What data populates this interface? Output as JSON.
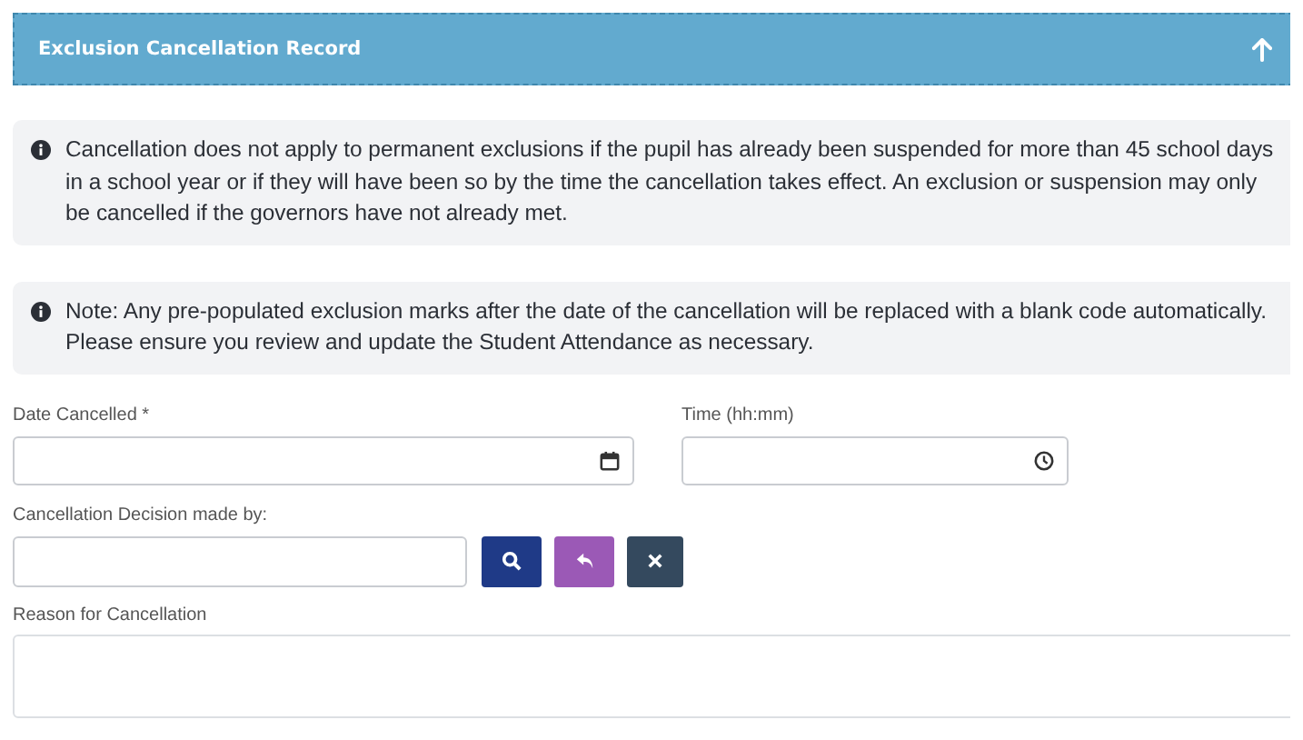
{
  "panel": {
    "title": "Exclusion Cancellation Record",
    "expanded": true
  },
  "notices": [
    "Cancellation does not apply to permanent exclusions if the pupil has already been suspended for more than 45 school days in a school year or if they will have been so by the time the cancellation takes effect. An exclusion or suspension may only be cancelled if the governors have not already met.",
    "Note: Any pre-populated exclusion marks after the date of the cancellation will be replaced with a blank code automatically. Please ensure you review and update the Student Attendance as necessary."
  ],
  "date_field": {
    "label": "Date Cancelled *"
  },
  "time_field": {
    "label": "Time (hh:mm)"
  },
  "decision_field": {
    "label": "Cancellation Decision made by:"
  },
  "reason_field": {
    "label": "Reason for Cancellation"
  }
}
